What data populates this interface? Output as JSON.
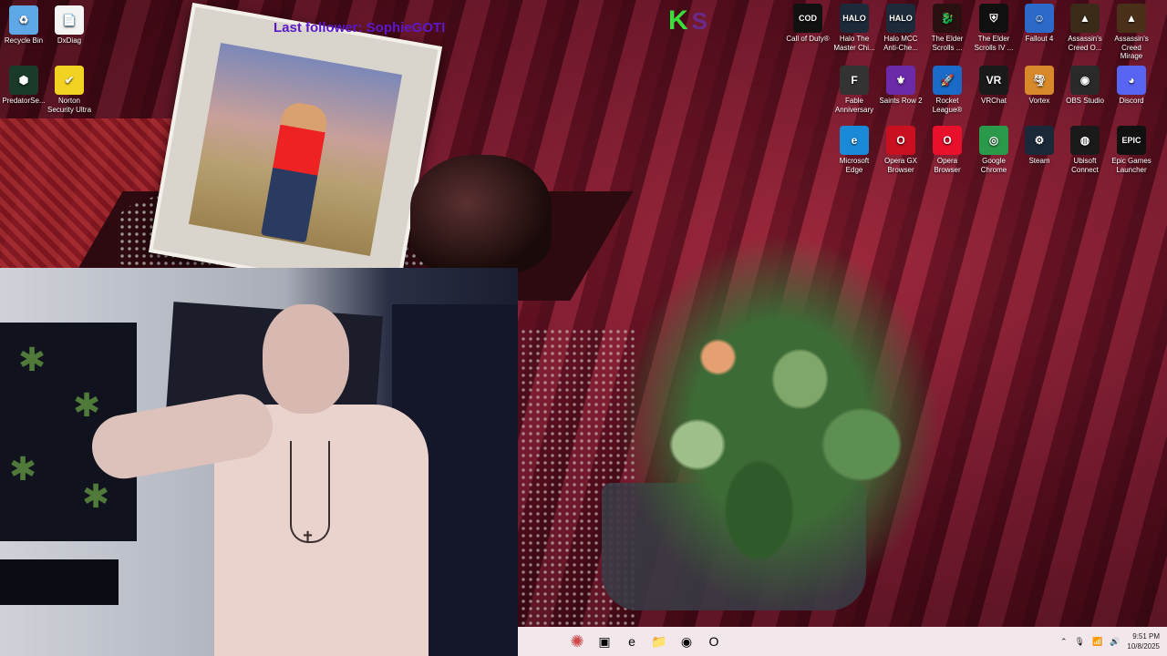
{
  "desktop": {
    "watermark": "Last follower: SophieGOTI",
    "badge": {
      "k": "K",
      "s": "S"
    },
    "icons_left": [
      {
        "name": "recycle-bin-icon",
        "label": "Recycle Bin",
        "glyph": "♻",
        "color": "#5fa8e8"
      },
      {
        "name": "dxdiag-icon",
        "label": "DxDiag",
        "glyph": "📄",
        "color": "#f4f4f4"
      },
      {
        "name": "predatorsense-icon",
        "label": "PredatorSe...",
        "glyph": "⬢",
        "color": "#1a3a2a"
      },
      {
        "name": "norton-icon",
        "label": "Norton Security Ultra",
        "glyph": "✔",
        "color": "#f2d321"
      }
    ],
    "icons_right": [
      {
        "name": "call-of-duty-icon",
        "label": "Call of Duty®",
        "glyph": "COD",
        "color": "#111"
      },
      {
        "name": "halo-master-chief-icon",
        "label": "Halo The Master Chi...",
        "glyph": "HALO",
        "color": "#1d2a3a"
      },
      {
        "name": "halo-mcc-anticheat-icon",
        "label": "Halo MCC Anti-Che...",
        "glyph": "HALO",
        "color": "#1d2a3a"
      },
      {
        "name": "elder-scrolls-online-icon",
        "label": "The Elder Scrolls ...",
        "glyph": "🐉",
        "color": "#2a1010"
      },
      {
        "name": "elder-scrolls-iv-icon",
        "label": "The Elder Scrolls IV ...",
        "glyph": "⛨",
        "color": "#101010"
      },
      {
        "name": "fallout-4-icon",
        "label": "Fallout 4",
        "glyph": "☺",
        "color": "#2b6ac8"
      },
      {
        "name": "assassins-creed-origins-icon",
        "label": "Assassin's Creed O...",
        "glyph": "▲",
        "color": "#3a2a18"
      },
      {
        "name": "assassins-creed-mirage-icon",
        "label": "Assassin's Creed Mirage",
        "glyph": "▲",
        "color": "#4a3018"
      },
      {
        "name": "fable-anniversary-icon",
        "label": "Fable Anniversary",
        "glyph": "F",
        "color": "#333"
      },
      {
        "name": "saints-row-2-icon",
        "label": "Saints Row 2",
        "glyph": "⚜",
        "color": "#6b2aa8"
      },
      {
        "name": "rocket-league-icon",
        "label": "Rocket League®",
        "glyph": "🚀",
        "color": "#1a6ac8"
      },
      {
        "name": "vrchat-icon",
        "label": "VRChat",
        "glyph": "VR",
        "color": "#1a1a1a"
      },
      {
        "name": "vortex-icon",
        "label": "Vortex",
        "glyph": "🌪",
        "color": "#d88a2a"
      },
      {
        "name": "obs-studio-icon",
        "label": "OBS Studio",
        "glyph": "◉",
        "color": "#2a2a2a"
      },
      {
        "name": "discord-icon",
        "label": "Discord",
        "glyph": "◕",
        "color": "#5865f2"
      },
      {
        "name": "microsoft-edge-icon",
        "label": "Microsoft Edge",
        "glyph": "e",
        "color": "#1a8ad8"
      },
      {
        "name": "opera-gx-icon",
        "label": "Opera GX Browser",
        "glyph": "O",
        "color": "#c81020"
      },
      {
        "name": "opera-browser-icon",
        "label": "Opera Browser",
        "glyph": "O",
        "color": "#e8102a"
      },
      {
        "name": "google-chrome-icon",
        "label": "Google Chrome",
        "glyph": "◎",
        "color": "#2a9a4a"
      },
      {
        "name": "steam-icon",
        "label": "Steam",
        "glyph": "⚙",
        "color": "#1b2838"
      },
      {
        "name": "ubisoft-connect-icon",
        "label": "Ubisoft Connect",
        "glyph": "◍",
        "color": "#1a1a1a"
      },
      {
        "name": "epic-games-icon",
        "label": "Epic Games Launcher",
        "glyph": "EPIC",
        "color": "#111"
      }
    ]
  },
  "taskbar": {
    "apps": [
      {
        "name": "start-icon",
        "glyph": "✺"
      },
      {
        "name": "task-view-icon",
        "glyph": "▣"
      },
      {
        "name": "edge-taskbar-icon",
        "glyph": "e"
      },
      {
        "name": "file-explorer-icon",
        "glyph": "📁"
      },
      {
        "name": "obs-taskbar-icon",
        "glyph": "◉"
      },
      {
        "name": "opera-taskbar-icon",
        "glyph": "O"
      }
    ],
    "time": "9:51 PM",
    "date": "10/8/2025"
  }
}
